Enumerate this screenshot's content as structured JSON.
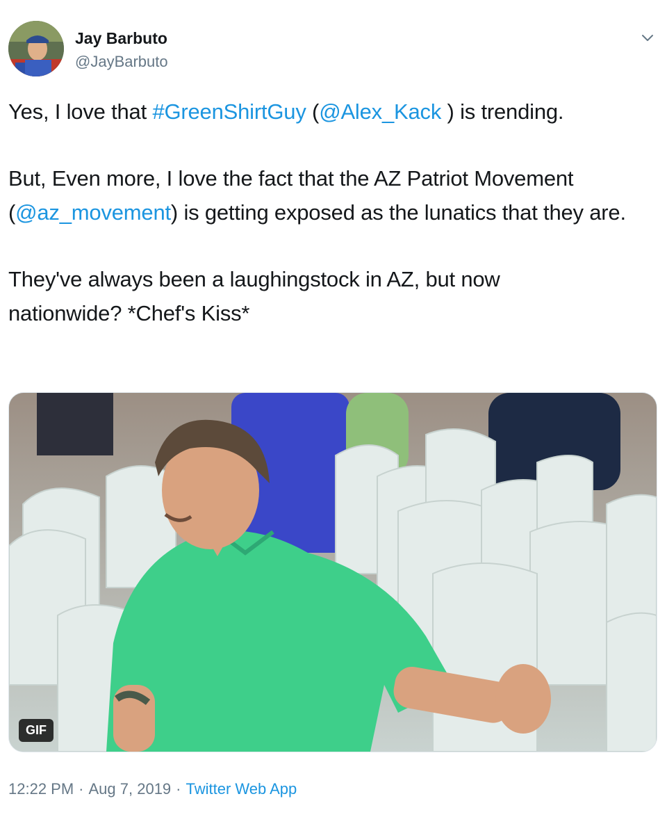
{
  "author": {
    "name": "Jay Barbuto",
    "handle": "@JayBarbuto",
    "avatar_icon": "profile-photo"
  },
  "menu_icon": "chevron-down-icon",
  "tweet": {
    "line1": {
      "before": "Yes, I love that ",
      "hashtag": "#GreenShirtGuy",
      "mid": " (",
      "mention": "@Alex_Kack",
      "after": " ) is trending."
    },
    "line2": {
      "before": "But, Even more, I love the fact that the AZ Patriot Movement  (",
      "mention": "@az_movement",
      "after": ") is getting exposed as the lunatics that they are."
    },
    "line3": "They've always been a laughingstock in AZ, but now nationwide? *Chef's Kiss*"
  },
  "media": {
    "badge": "GIF"
  },
  "meta": {
    "time": "12:22 PM",
    "separator": "·",
    "date": "Aug 7, 2019",
    "source": "Twitter Web App"
  },
  "colors": {
    "link": "#1b95e0",
    "muted": "#657786",
    "text": "#14171a"
  }
}
